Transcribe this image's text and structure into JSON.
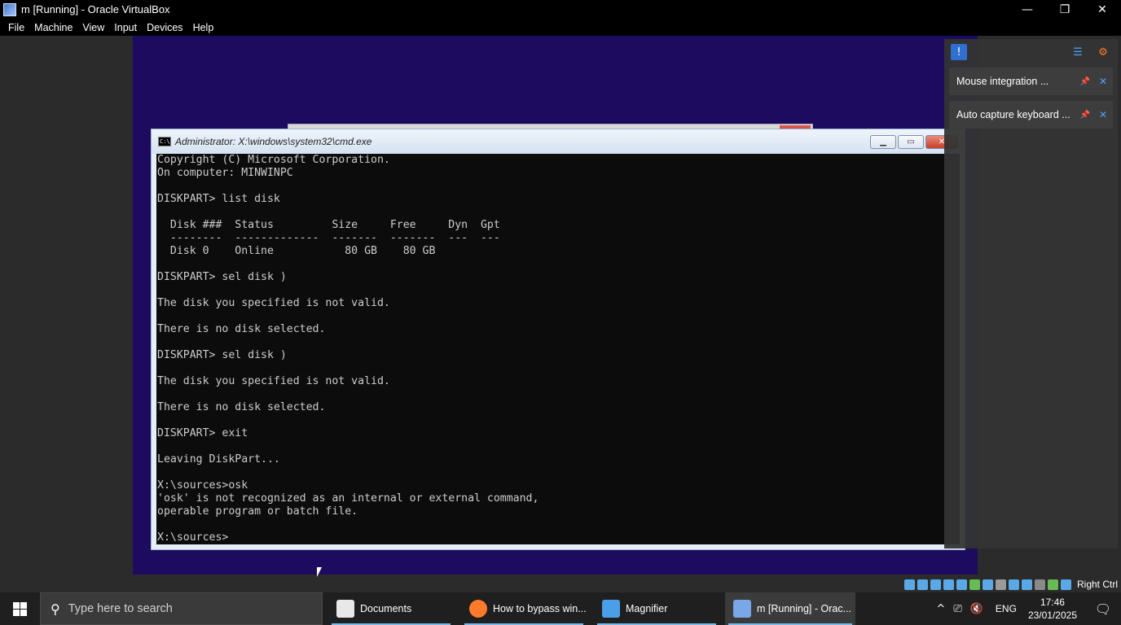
{
  "window": {
    "title": "m [Running] - Oracle VirtualBox",
    "minimize": "—",
    "maximize": "❐",
    "close": "✕"
  },
  "menu": [
    "File",
    "Machine",
    "View",
    "Input",
    "Devices",
    "Help"
  ],
  "cmd": {
    "title": "Administrator: X:\\windows\\system32\\cmd.exe",
    "icon_text": "C:\\",
    "btn_min": "▁",
    "btn_max": "▭",
    "btn_close": "✕",
    "lines": [
      "Copyright (C) Microsoft Corporation.",
      "On computer: MINWINPC",
      "",
      "DISKPART> list disk",
      "",
      "  Disk ###  Status         Size     Free     Dyn  Gpt",
      "  --------  -------------  -------  -------  ---  ---",
      "  Disk 0    Online           80 GB    80 GB",
      "",
      "DISKPART> sel disk )",
      "",
      "The disk you specified is not valid.",
      "",
      "There is no disk selected.",
      "",
      "DISKPART> sel disk )",
      "",
      "The disk you specified is not valid.",
      "",
      "There is no disk selected.",
      "",
      "DISKPART> exit",
      "",
      "Leaving DiskPart...",
      "",
      "X:\\sources>osk",
      "'osk' is not recognized as an internal or external command,",
      "operable program or batch file.",
      "",
      "X:\\sources>"
    ]
  },
  "notifications": [
    {
      "text": "Mouse integration ...",
      "pin": "📌",
      "close": "✕"
    },
    {
      "text": "Auto capture keyboard ...",
      "pin": "📌",
      "close": "✕"
    }
  ],
  "notif_icons": {
    "left": "!",
    "middle": "☰",
    "right": "⚙"
  },
  "status_bar": {
    "host_key": "Right Ctrl",
    "icon_colors": [
      "#5aa9e6",
      "#5aa9e6",
      "#5aa9e6",
      "#5aa9e6",
      "#5aa9e6",
      "#66bb55",
      "#5aa9e6",
      "#9a9a9a",
      "#5aa9e6",
      "#5aa9e6",
      "#8a8a8a",
      "#66bb55",
      "#5aa9e6"
    ]
  },
  "taskbar": {
    "search_placeholder": "Type here to search",
    "search_icon": "⚲",
    "tasks": [
      {
        "label": "Documents",
        "icon": "documents-icon",
        "color": "#e8e8e8"
      },
      {
        "label": "How to bypass win...",
        "icon": "firefox-icon",
        "color": "#ff7a2a"
      },
      {
        "label": "Magnifier",
        "icon": "magnifier-icon",
        "color": "#4aa0e8"
      },
      {
        "label": "m [Running] - Orac...",
        "icon": "virtualbox-icon",
        "color": "#7aa7e8"
      }
    ],
    "tray": {
      "chevron": "^",
      "network": "⎚",
      "volume": "🔇",
      "language": "ENG",
      "time": "17:46",
      "date": "23/01/2025",
      "notification": "🗨"
    }
  },
  "colors": {
    "guest_background": "#1d0b5f",
    "console_background": "#0c0c0c",
    "console_text": "#cccccc",
    "taskbar_accent": "#76b9ed"
  }
}
